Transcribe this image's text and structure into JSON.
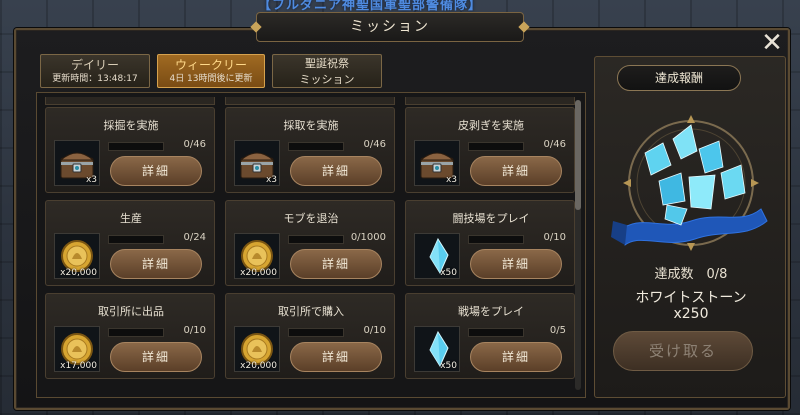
{
  "background": {
    "banner_text": "【フルダニア神聖国軍聖部警備隊】"
  },
  "window": {
    "title": "ミッション",
    "close_label": "✕"
  },
  "tabs": [
    {
      "label": "デイリー",
      "sub": "更新時間：13:48:17",
      "active": false
    },
    {
      "label": "ウィークリー",
      "sub": "4日 13時間後に更新",
      "active": true
    },
    {
      "label": "聖誕祝祭",
      "sub": "ミッション",
      "active": false
    }
  ],
  "missions": [
    {
      "title": "採掘を実施",
      "progress": "0/46",
      "progress_value": 0,
      "reward_icon": "chest-icon",
      "reward_qty": "x3",
      "button": "詳細"
    },
    {
      "title": "採取を実施",
      "progress": "0/46",
      "progress_value": 0,
      "reward_icon": "chest-icon",
      "reward_qty": "x3",
      "button": "詳細"
    },
    {
      "title": "皮剥ぎを実施",
      "progress": "0/46",
      "progress_value": 0,
      "reward_icon": "chest-icon",
      "reward_qty": "x3",
      "button": "詳細"
    },
    {
      "title": "生産",
      "progress": "0/24",
      "progress_value": 0,
      "reward_icon": "gold-coin-icon",
      "reward_qty": "x20,000",
      "button": "詳細"
    },
    {
      "title": "モブを退治",
      "progress": "0/1000",
      "progress_value": 0,
      "reward_icon": "gold-coin-icon",
      "reward_qty": "x20,000",
      "button": "詳細"
    },
    {
      "title": "闘技場をプレイ",
      "progress": "0/10",
      "progress_value": 0,
      "reward_icon": "crystal-icon",
      "reward_qty": "x50",
      "button": "詳細"
    },
    {
      "title": "取引所に出品",
      "progress": "0/10",
      "progress_value": 0,
      "reward_icon": "gold-coin-icon",
      "reward_qty": "x17,000",
      "button": "詳細"
    },
    {
      "title": "取引所で購入",
      "progress": "0/10",
      "progress_value": 0,
      "reward_icon": "gold-coin-icon",
      "reward_qty": "x20,000",
      "button": "詳細"
    },
    {
      "title": "戦場をプレイ",
      "progress": "0/5",
      "progress_value": 0,
      "reward_icon": "crystal-icon",
      "reward_qty": "x50",
      "button": "詳細"
    }
  ],
  "reward": {
    "title": "達成報酬",
    "count": "達成数　0/8",
    "item_name": "ホワイトストーン",
    "item_qty": "x250",
    "receive_label": "受け取る",
    "receive_enabled": false,
    "icon": "white-stone-icon"
  },
  "colors": {
    "accent": "#c39a4a",
    "active_tab": "#a06a22",
    "button": "#7a5838"
  }
}
